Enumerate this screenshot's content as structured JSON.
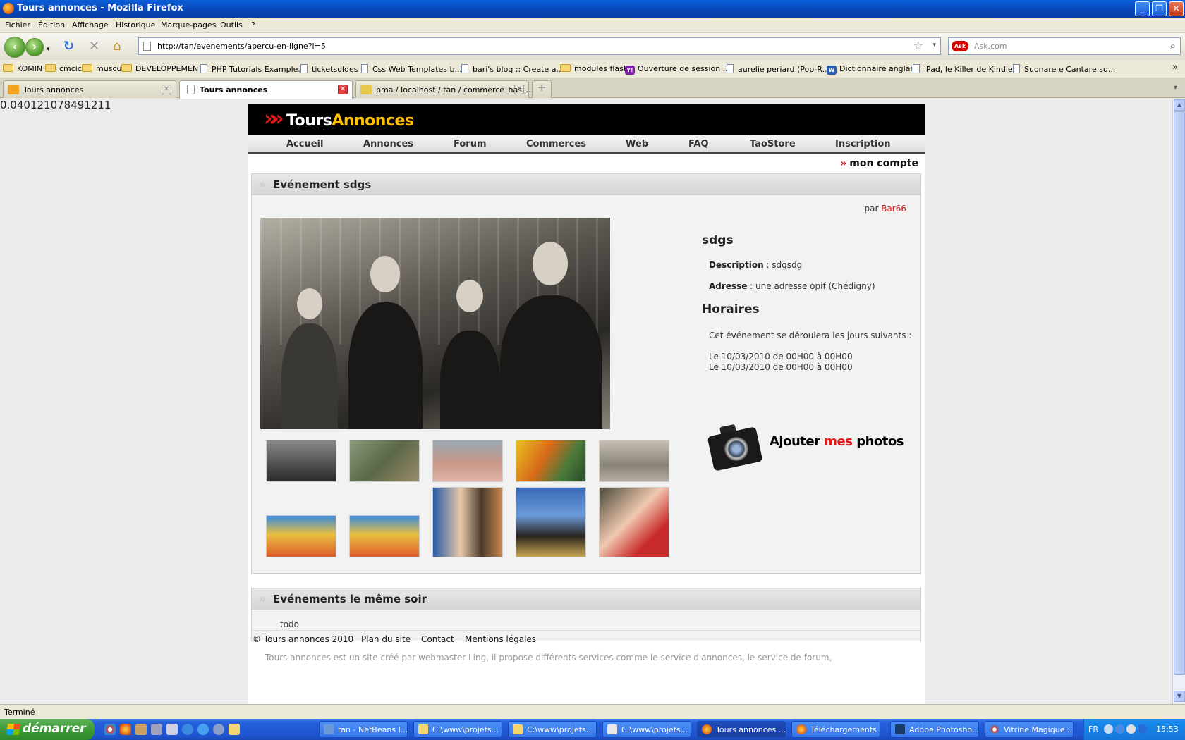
{
  "window": {
    "title": "Tours annonces - Mozilla Firefox",
    "controls": [
      "_",
      "❐",
      "✕"
    ]
  },
  "menu": [
    "Fichier",
    "Édition",
    "Affichage",
    "Historique",
    "Marque-pages",
    "Outils",
    "?"
  ],
  "navbar": {
    "back_glyph": "‹",
    "forward_glyph": "›",
    "reload_glyph": "↻",
    "stop_glyph": "✕",
    "home_glyph": "⌂",
    "url": "http://tan/evenements/apercu-en-ligne?i=5",
    "star_glyph": "☆",
    "drop_glyph": "▾",
    "search_engine_label": "Ask",
    "search_placeholder": "Ask.com",
    "search_glyph": "⌕"
  },
  "bookmarks": [
    {
      "label": "KOMIN",
      "icon": "folder-icon"
    },
    {
      "label": "cmcic",
      "icon": "folder-icon"
    },
    {
      "label": "muscu",
      "icon": "folder-icon"
    },
    {
      "label": "DEVELOPPEMENT",
      "icon": "folder-icon"
    },
    {
      "label": "PHP Tutorials Example...",
      "icon": "page-icon"
    },
    {
      "label": "ticketsoldes",
      "icon": "page-icon"
    },
    {
      "label": "Css Web Templates b...",
      "icon": "page-icon"
    },
    {
      "label": "bari's blog :: Create a...",
      "icon": "page-icon"
    },
    {
      "label": "modules flash",
      "icon": "folder-icon"
    },
    {
      "label": "Ouverture de session ...",
      "icon": "yahoo-icon"
    },
    {
      "label": "aurelie periard (Pop-R...",
      "icon": "page-icon"
    },
    {
      "label": "Dictionnaire anglais",
      "icon": "wr-icon"
    },
    {
      "label": "iPad, le Killer de Kindle...",
      "icon": "page-icon"
    },
    {
      "label": "Suonare e Cantare su...",
      "icon": "page-icon"
    }
  ],
  "bookmarks_overflow": "»",
  "tabs": [
    {
      "label": "Tours annonces",
      "active": false
    },
    {
      "label": "Tours annonces",
      "active": true
    },
    {
      "label": "pma / localhost / tan / commerce_has_...",
      "active": false
    }
  ],
  "tab_close_glyph": "✕",
  "new_tab_glyph": "+",
  "tab_list_glyph": "▾",
  "debug_value": "0.040121078491211",
  "site": {
    "logo_white": "Tours",
    "logo_yellow": "Annonces",
    "nav": [
      "Accueil",
      "Annonces",
      "Forum",
      "Commerces",
      "Web",
      "FAQ",
      "TaoStore",
      "Inscription"
    ],
    "account": "mon compte",
    "chevron": "»"
  },
  "event": {
    "section_title": "Evénement sdgs",
    "by_label": "par",
    "author": "Bar66",
    "name": "sdgs",
    "description_label": "Description",
    "description": " : sdgsdg",
    "address_label": "Adresse",
    "address": " : une adresse opif (Chédigny)",
    "schedule_title": "Horaires",
    "schedule_intro": "Cet événement se déroulera les jours suivants :",
    "schedule": [
      "Le 10/03/2010 de 00H00 à 00H00",
      "Le 10/03/2010 de 00H00 à 00H00"
    ],
    "add_photos_black_1": "Ajouter ",
    "add_photos_red": "mes",
    "add_photos_black_2": " photos"
  },
  "same_evening": {
    "title": "Evénements le même soir",
    "content": "todo"
  },
  "footer": {
    "copyright": "© Tours annonces 2010",
    "links": [
      "Plan du site",
      "Contact",
      "Mentions légales"
    ],
    "description": "Tours annonces est un site créé par webmaster Ling, il propose différents services comme le service d'annonces, le service de forum,"
  },
  "status": "Terminé",
  "taskbar": {
    "start": "démarrer",
    "tasks": [
      "tan - NetBeans I...",
      "C:\\www\\projets...",
      "C:\\www\\projets...",
      "C:\\www\\projets...",
      "Tours annonces ...",
      "Téléchargements",
      "Adobe Photosho...",
      "Vitrine Magique :..."
    ],
    "lang": "FR",
    "clock": "15:53"
  }
}
